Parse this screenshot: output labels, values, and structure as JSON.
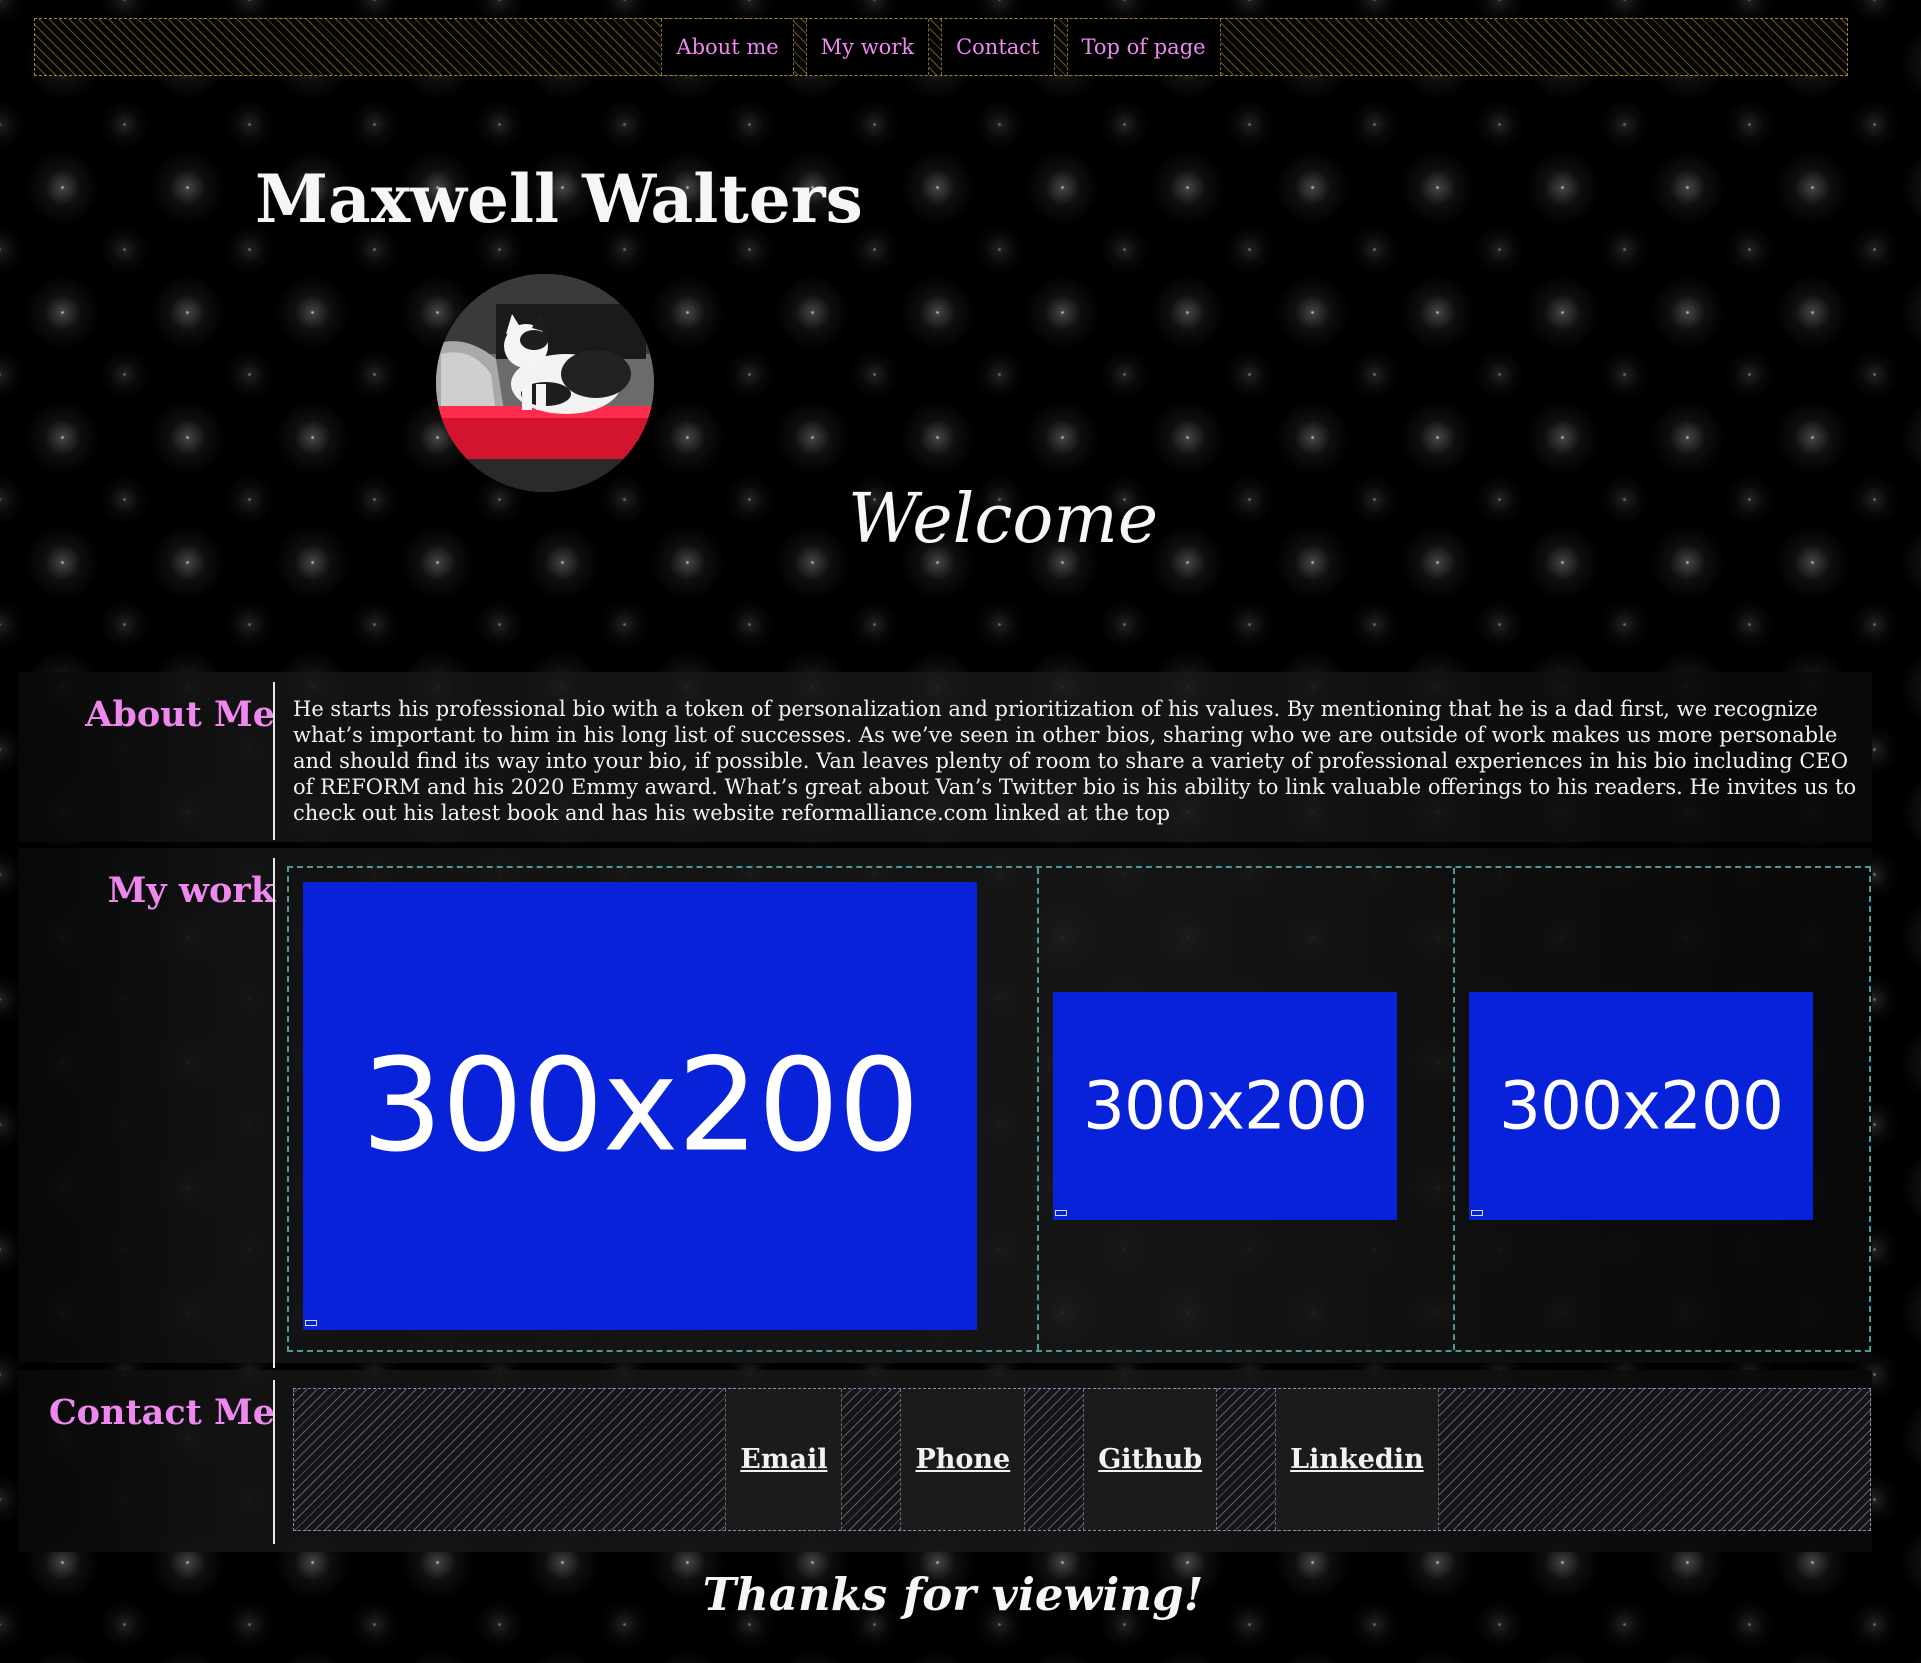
{
  "nav": {
    "items": [
      {
        "label": "About me"
      },
      {
        "label": "My work"
      },
      {
        "label": "Contact"
      },
      {
        "label": "Top of page"
      }
    ]
  },
  "header": {
    "name": "Maxwell Walters",
    "welcome": "Welcome"
  },
  "about": {
    "heading": "About Me",
    "text": "He starts his professional bio with a token of personalization and prioritization of his values. By mentioning that he is a dad first, we recognize what’s important to him in his long list of successes. As we’ve seen in other bios, sharing who we are outside of work makes us more personable and should find its way into your bio, if possible. Van leaves plenty of room to share a variety of professional experiences in his bio including CEO of REFORM and his 2020 Emmy award. What’s great about Van’s Twitter bio is his ability to link valuable offerings to his readers. He invites us to check out his latest book and has his website reformalliance.com linked at the top"
  },
  "work": {
    "heading": "My work",
    "items": [
      {
        "label": "300x200"
      },
      {
        "label": "300x200"
      },
      {
        "label": "300x200"
      }
    ],
    "placeholder_color": "#0722d9"
  },
  "contact": {
    "heading": "Contact Me",
    "links": [
      {
        "label": "Email"
      },
      {
        "label": "Phone"
      },
      {
        "label": "Github"
      },
      {
        "label": "Linkedin"
      }
    ]
  },
  "footer": {
    "text": "Thanks for viewing!"
  },
  "colors": {
    "accent": "#ee88ee",
    "background": "#000000",
    "text": "#ffffff",
    "nav_pattern": "#be913c",
    "work_border": "#4a9a9a",
    "contact_pattern": "#9696c8"
  }
}
